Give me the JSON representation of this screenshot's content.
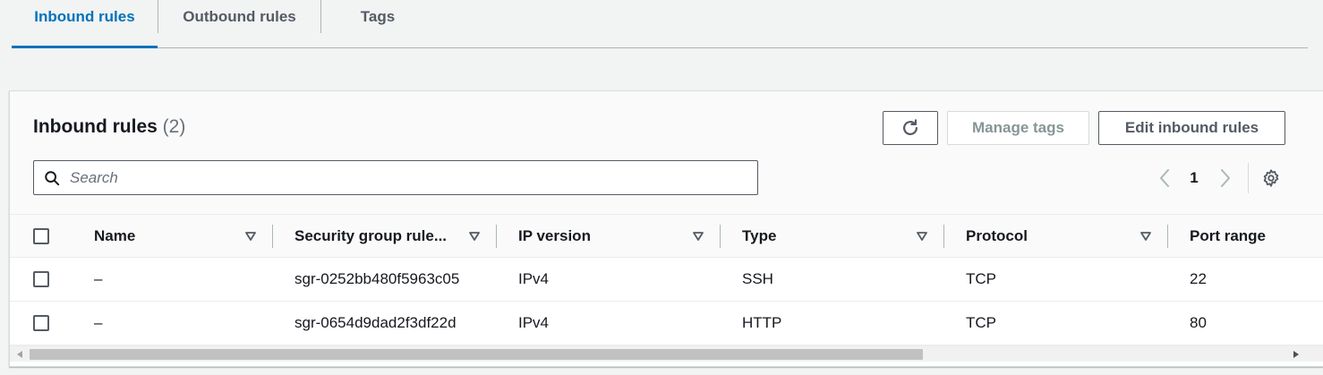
{
  "tabs": [
    {
      "label": "Inbound rules",
      "active": true
    },
    {
      "label": "Outbound rules",
      "active": false
    },
    {
      "label": "Tags",
      "active": false
    }
  ],
  "panel": {
    "title": "Inbound rules",
    "count": "(2)",
    "buttons": {
      "refresh_icon": "refresh-icon",
      "manage_tags": "Manage tags",
      "edit_inbound": "Edit inbound rules"
    },
    "search": {
      "placeholder": "Search",
      "value": ""
    },
    "pagination": {
      "current_page": "1"
    }
  },
  "table": {
    "columns": [
      "Name",
      "Security group rule...",
      "IP version",
      "Type",
      "Protocol",
      "Port range"
    ],
    "rows": [
      {
        "name": "–",
        "sgr": "sgr-0252bb480f5963c05",
        "ip_version": "IPv4",
        "type": "SSH",
        "protocol": "TCP",
        "port_range": "22"
      },
      {
        "name": "–",
        "sgr": "sgr-0654d9dad2f3df22d",
        "ip_version": "IPv4",
        "type": "HTTP",
        "protocol": "TCP",
        "port_range": "80"
      }
    ]
  },
  "colors": {
    "accent": "#0073bb",
    "text": "#16191f",
    "muted": "#545b64",
    "disabled": "#879596"
  }
}
